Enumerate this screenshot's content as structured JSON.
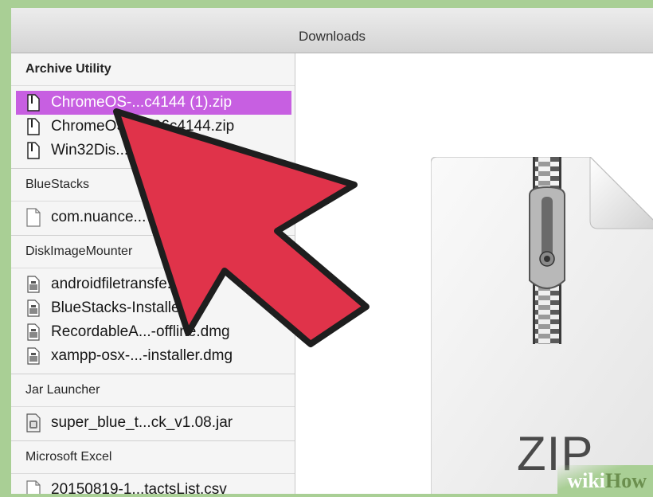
{
  "window": {
    "title": "Downloads"
  },
  "groups": [
    {
      "header": "Archive Utility",
      "items": [
        {
          "name": "ChromeOS-...c4144 (1).zip",
          "icon": "zip-file-icon",
          "selected": true
        },
        {
          "name": "ChromeOS-...706c4144.zip",
          "icon": "zip-file-icon"
        },
        {
          "name": "Win32Dis...zip",
          "icon": "zip-file-icon"
        }
      ]
    },
    {
      "header": "BlueStacks",
      "items": [
        {
          "name": "com.nuance...",
          "icon": "document-icon"
        }
      ]
    },
    {
      "header": "DiskImageMounter",
      "items": [
        {
          "name": "androidfiletransfe...",
          "icon": "disk-image-icon"
        },
        {
          "name": "BlueStacks-Installe...",
          "icon": "disk-image-icon"
        },
        {
          "name": "RecordableA...-offline.dmg",
          "icon": "disk-image-icon"
        },
        {
          "name": "xampp-osx-...-installer.dmg",
          "icon": "disk-image-icon"
        }
      ]
    },
    {
      "header": "Jar Launcher",
      "items": [
        {
          "name": "super_blue_t...ck_v1.08.jar",
          "icon": "jar-file-icon"
        }
      ]
    },
    {
      "header": "Microsoft Excel",
      "items": [
        {
          "name": "20150819-1...tactsList.csv",
          "icon": "document-icon"
        }
      ]
    }
  ],
  "preview": {
    "label": "ZIP",
    "icon": "zip-archive-icon"
  },
  "watermark": {
    "part1": "wiki",
    "part2": "How"
  },
  "colors": {
    "selection": "#c75fe1",
    "arrow": "#e0334a",
    "background": "#a9cf95"
  }
}
